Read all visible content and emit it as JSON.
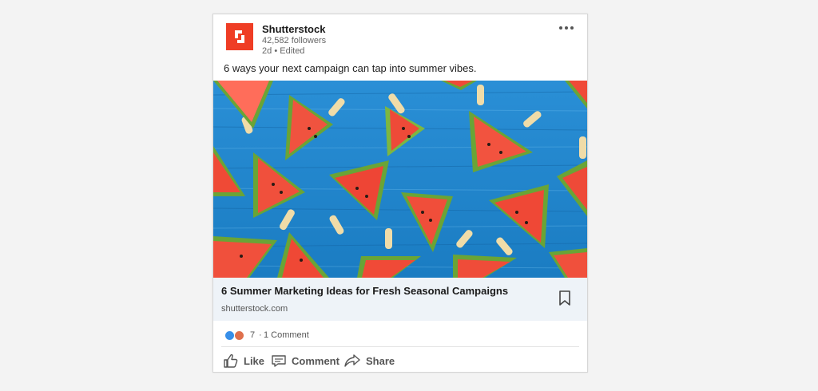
{
  "post": {
    "company_name": "Shutterstock",
    "followers": "42,582 followers",
    "time": "2d",
    "time_separator": "•",
    "edited": "Edited",
    "text": "6 ways your next campaign can tap into summer vibes.",
    "more_icon": "ellipsis-icon"
  },
  "link_preview": {
    "title": "6 Summer Marketing Ideas for Fresh Seasonal Campaigns",
    "domain": "shutterstock.com",
    "bookmark_icon": "bookmark-icon"
  },
  "social": {
    "reaction_icons": [
      "like-reaction-icon",
      "love-reaction-icon"
    ],
    "reaction_count": "7",
    "separator": "·",
    "comments": "1 Comment"
  },
  "actions": [
    {
      "label": "Like",
      "icon": "thumbs-up-icon"
    },
    {
      "label": "Comment",
      "icon": "comment-icon"
    },
    {
      "label": "Share",
      "icon": "share-arrow-icon"
    }
  ],
  "colors": {
    "brand": "#ef3d25",
    "image_background": "#1f86cc",
    "link_box": "#eef3f8"
  }
}
